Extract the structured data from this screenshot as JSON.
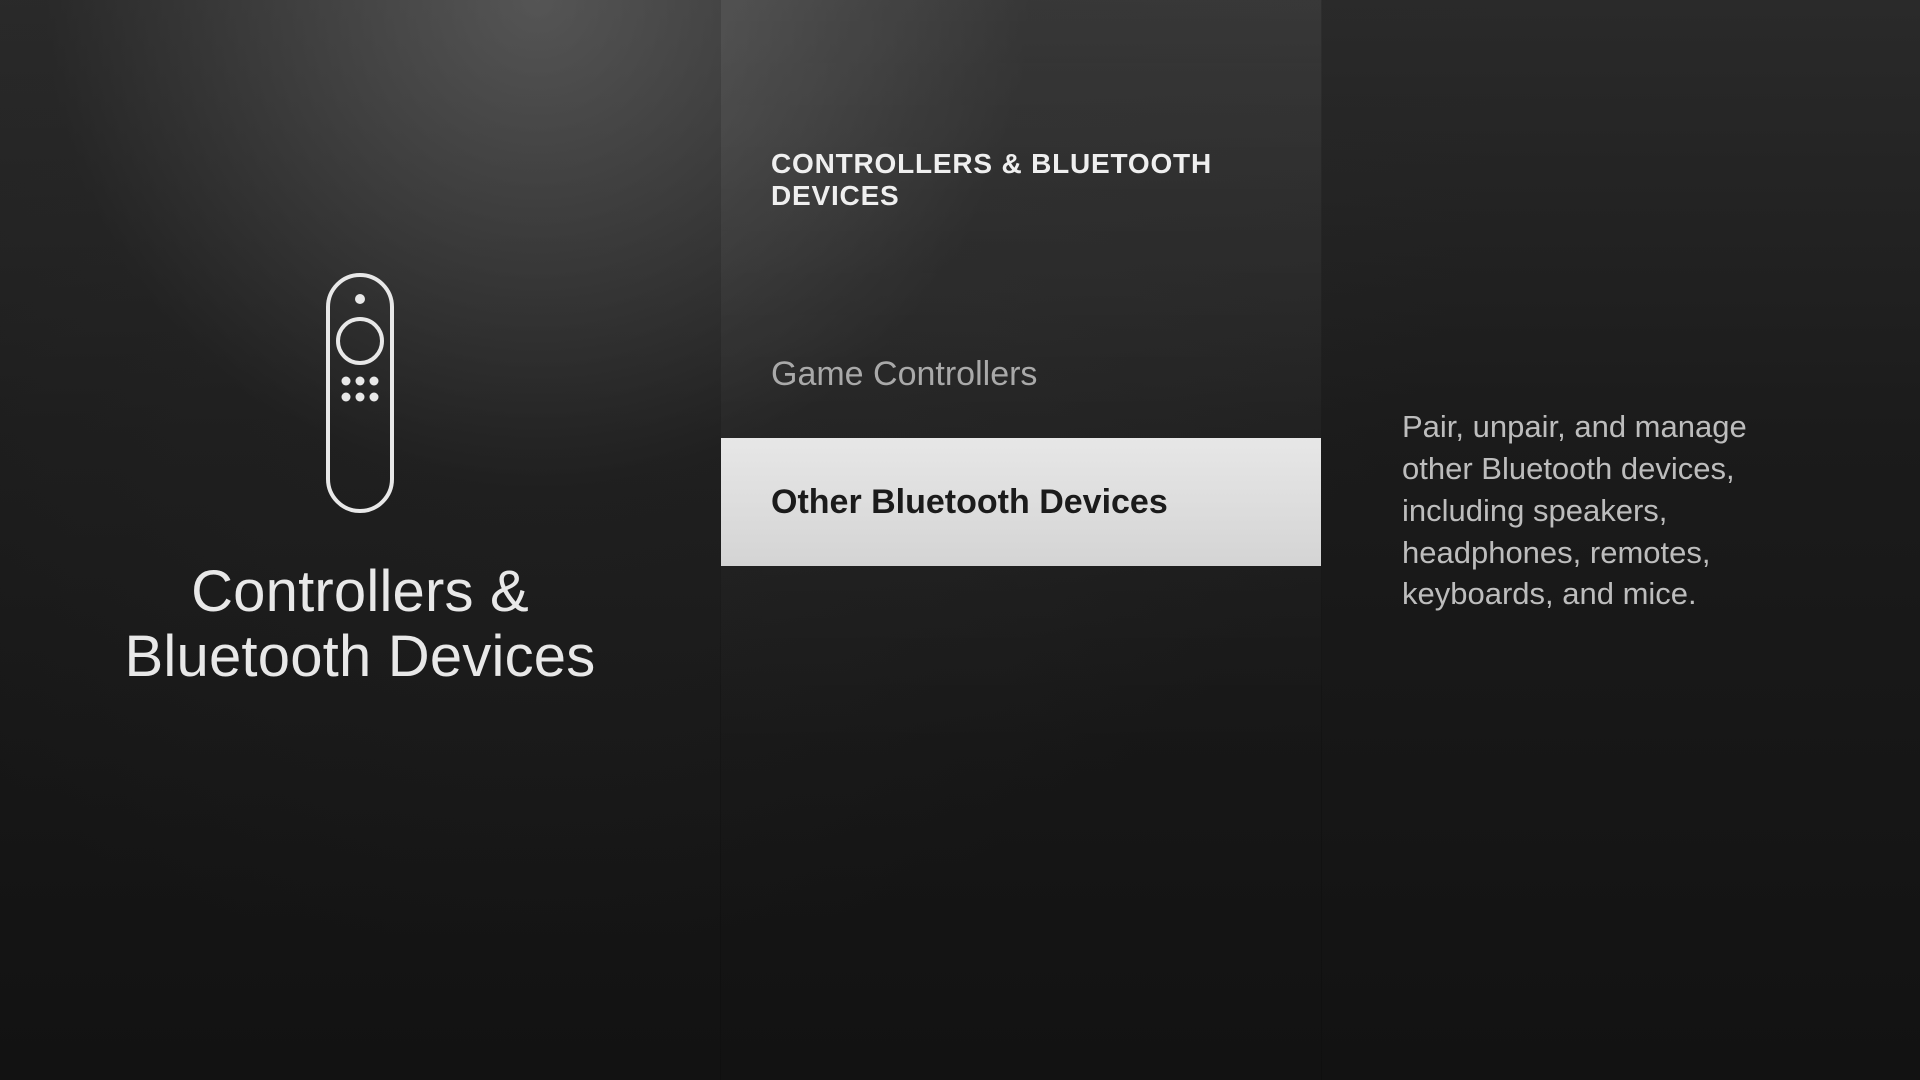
{
  "category": {
    "title_line1": "Controllers &",
    "title_line2": "Bluetooth Devices"
  },
  "mid": {
    "heading": "CONTROLLERS & BLUETOOTH DEVICES",
    "items": [
      {
        "label": "Game Controllers",
        "selected": false
      },
      {
        "label": "Other Bluetooth Devices",
        "selected": true
      }
    ]
  },
  "description": "Pair, unpair, and manage other Bluetooth devices, including speakers, headphones, remotes, keyboards, and mice."
}
